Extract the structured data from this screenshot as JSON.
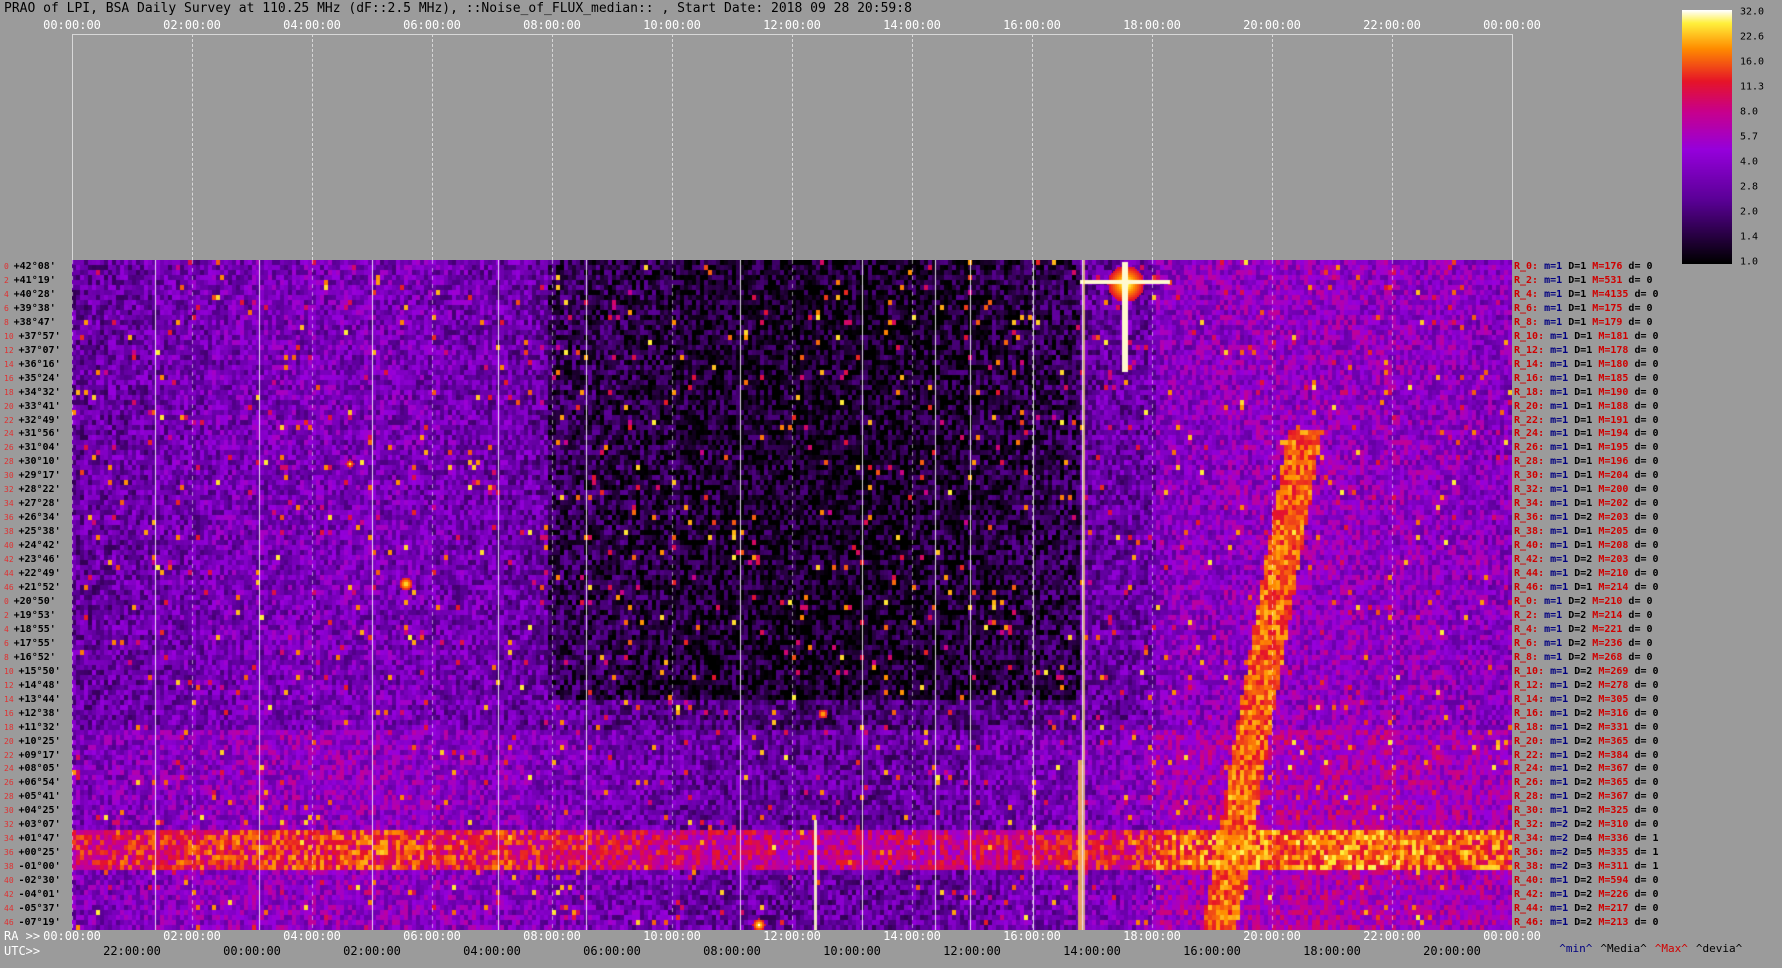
{
  "title": "PRAO of LPI, BSA Daily Survey at 110.25 MHz (dF::2.5 MHz), ::Noise_of_FLUX_median:: , Start Date: 2018 09 28 20:59:8",
  "top_ticks": [
    "00:00:00",
    "02:00:00",
    "04:00:00",
    "06:00:00",
    "08:00:00",
    "10:00:00",
    "12:00:00",
    "14:00:00",
    "16:00:00",
    "18:00:00",
    "20:00:00",
    "22:00:00",
    "00:00:00"
  ],
  "ra_label": "RA >>",
  "utc_label": "UTC>>",
  "ra_ticks": [
    "00:00:00",
    "02:00:00",
    "04:00:00",
    "06:00:00",
    "08:00:00",
    "10:00:00",
    "12:00:00",
    "14:00:00",
    "16:00:00",
    "18:00:00",
    "20:00:00",
    "22:00:00",
    "00:00:00"
  ],
  "utc_ticks": [
    "22:00:00",
    "00:00:00",
    "02:00:00",
    "04:00:00",
    "06:00:00",
    "08:00:00",
    "10:00:00",
    "12:00:00",
    "14:00:00",
    "16:00:00",
    "18:00:00",
    "20:00:00"
  ],
  "legend_foot": {
    "min": "^min^",
    "media": "^Media^",
    "max": "^Max^",
    "devia": "^devia^"
  },
  "colors": {
    "background": "#9b9b9b",
    "min": "#000080",
    "media": "#000000",
    "max": "#d00000",
    "devia": "#000000"
  },
  "chart_data": {
    "type": "heatmap",
    "x_axis": {
      "label": "RA / UTC",
      "range": [
        "00:00:00",
        "24:00:00"
      ]
    },
    "declinations": [
      "+42°08'",
      "+41°19'",
      "+40°28'",
      "+39°38'",
      "+38°47'",
      "+37°57'",
      "+37°07'",
      "+36°16'",
      "+35°24'",
      "+34°32'",
      "+33°41'",
      "+32°49'",
      "+31°56'",
      "+31°04'",
      "+30°10'",
      "+29°17'",
      "+28°22'",
      "+27°28'",
      "+26°34'",
      "+25°38'",
      "+24°42'",
      "+23°46'",
      "+22°49'",
      "+21°52'",
      "+20°50'",
      "+19°53'",
      "+18°55'",
      "+17°55'",
      "+16°52'",
      "+15°50'",
      "+14°48'",
      "+13°44'",
      "+12°38'",
      "+11°32'",
      "+10°25'",
      "+09°17'",
      "+08°05'",
      "+06°54'",
      "+05°41'",
      "+04°25'",
      "+03°07'",
      "+01°47'",
      "+00°25'",
      "-01°00'",
      "-02°30'",
      "-04°01'",
      "-05°37'",
      "-07°19'"
    ],
    "row_indices": [
      "0",
      "2",
      "4",
      "6",
      "8",
      "10",
      "12",
      "14",
      "16",
      "18",
      "20",
      "22",
      "24",
      "26",
      "28",
      "30",
      "32",
      "34",
      "36",
      "38",
      "40",
      "42",
      "44",
      "46",
      "0",
      "2",
      "4",
      "6",
      "8",
      "10",
      "12",
      "14",
      "16",
      "18",
      "20",
      "22",
      "24",
      "26",
      "28",
      "30",
      "32",
      "34",
      "36",
      "38",
      "40",
      "42",
      "44",
      "46"
    ],
    "colorbar": {
      "ticks": [
        "32.0",
        "22.6",
        "16.0",
        "11.3",
        "8.0",
        "5.7",
        "4.0",
        "2.8",
        "2.0",
        "1.4",
        "1.0"
      ],
      "range": [
        1.0,
        32.0
      ],
      "scale": "log"
    },
    "row_stats": [
      {
        "name": "R_0:",
        "m": "m=1",
        "D": "D=1",
        "M": "M=176",
        "d": "d= 0"
      },
      {
        "name": "R_2:",
        "m": "m=1",
        "D": "D=1",
        "M": "M=531",
        "d": "d= 0"
      },
      {
        "name": "R_4:",
        "m": "m=1",
        "D": "D=1",
        "M": "M=4135",
        "d": "d= 0"
      },
      {
        "name": "R_6:",
        "m": "m=1",
        "D": "D=1",
        "M": "M=175",
        "d": "d= 0"
      },
      {
        "name": "R_8:",
        "m": "m=1",
        "D": "D=1",
        "M": "M=179",
        "d": "d= 0"
      },
      {
        "name": "R_10:",
        "m": "m=1",
        "D": "D=1",
        "M": "M=181",
        "d": "d= 0"
      },
      {
        "name": "R_12:",
        "m": "m=1",
        "D": "D=1",
        "M": "M=178",
        "d": "d= 0"
      },
      {
        "name": "R_14:",
        "m": "m=1",
        "D": "D=1",
        "M": "M=180",
        "d": "d= 0"
      },
      {
        "name": "R_16:",
        "m": "m=1",
        "D": "D=1",
        "M": "M=185",
        "d": "d= 0"
      },
      {
        "name": "R_18:",
        "m": "m=1",
        "D": "D=1",
        "M": "M=190",
        "d": "d= 0"
      },
      {
        "name": "R_20:",
        "m": "m=1",
        "D": "D=1",
        "M": "M=188",
        "d": "d= 0"
      },
      {
        "name": "R_22:",
        "m": "m=1",
        "D": "D=1",
        "M": "M=191",
        "d": "d= 0"
      },
      {
        "name": "R_24:",
        "m": "m=1",
        "D": "D=1",
        "M": "M=194",
        "d": "d= 0"
      },
      {
        "name": "R_26:",
        "m": "m=1",
        "D": "D=1",
        "M": "M=195",
        "d": "d= 0"
      },
      {
        "name": "R_28:",
        "m": "m=1",
        "D": "D=1",
        "M": "M=196",
        "d": "d= 0"
      },
      {
        "name": "R_30:",
        "m": "m=1",
        "D": "D=1",
        "M": "M=204",
        "d": "d= 0"
      },
      {
        "name": "R_32:",
        "m": "m=1",
        "D": "D=1",
        "M": "M=200",
        "d": "d= 0"
      },
      {
        "name": "R_34:",
        "m": "m=1",
        "D": "D=1",
        "M": "M=202",
        "d": "d= 0"
      },
      {
        "name": "R_36:",
        "m": "m=1",
        "D": "D=2",
        "M": "M=203",
        "d": "d= 0"
      },
      {
        "name": "R_38:",
        "m": "m=1",
        "D": "D=1",
        "M": "M=205",
        "d": "d= 0"
      },
      {
        "name": "R_40:",
        "m": "m=1",
        "D": "D=1",
        "M": "M=208",
        "d": "d= 0"
      },
      {
        "name": "R_42:",
        "m": "m=1",
        "D": "D=2",
        "M": "M=203",
        "d": "d= 0"
      },
      {
        "name": "R_44:",
        "m": "m=1",
        "D": "D=2",
        "M": "M=210",
        "d": "d= 0"
      },
      {
        "name": "R_46:",
        "m": "m=1",
        "D": "D=1",
        "M": "M=214",
        "d": "d= 0"
      },
      {
        "name": "R_0:",
        "m": "m=1",
        "D": "D=2",
        "M": "M=210",
        "d": "d= 0"
      },
      {
        "name": "R_2:",
        "m": "m=1",
        "D": "D=2",
        "M": "M=214",
        "d": "d= 0"
      },
      {
        "name": "R_4:",
        "m": "m=1",
        "D": "D=2",
        "M": "M=221",
        "d": "d= 0"
      },
      {
        "name": "R_6:",
        "m": "m=1",
        "D": "D=2",
        "M": "M=236",
        "d": "d= 0"
      },
      {
        "name": "R_8:",
        "m": "m=1",
        "D": "D=2",
        "M": "M=268",
        "d": "d= 0"
      },
      {
        "name": "R_10:",
        "m": "m=1",
        "D": "D=2",
        "M": "M=269",
        "d": "d= 0"
      },
      {
        "name": "R_12:",
        "m": "m=1",
        "D": "D=2",
        "M": "M=278",
        "d": "d= 0"
      },
      {
        "name": "R_14:",
        "m": "m=1",
        "D": "D=2",
        "M": "M=305",
        "d": "d= 0"
      },
      {
        "name": "R_16:",
        "m": "m=1",
        "D": "D=2",
        "M": "M=316",
        "d": "d= 0"
      },
      {
        "name": "R_18:",
        "m": "m=1",
        "D": "D=2",
        "M": "M=331",
        "d": "d= 0"
      },
      {
        "name": "R_20:",
        "m": "m=1",
        "D": "D=2",
        "M": "M=365",
        "d": "d= 0"
      },
      {
        "name": "R_22:",
        "m": "m=1",
        "D": "D=2",
        "M": "M=384",
        "d": "d= 0"
      },
      {
        "name": "R_24:",
        "m": "m=1",
        "D": "D=2",
        "M": "M=367",
        "d": "d= 0"
      },
      {
        "name": "R_26:",
        "m": "m=1",
        "D": "D=2",
        "M": "M=365",
        "d": "d= 0"
      },
      {
        "name": "R_28:",
        "m": "m=1",
        "D": "D=2",
        "M": "M=367",
        "d": "d= 0"
      },
      {
        "name": "R_30:",
        "m": "m=1",
        "D": "D=2",
        "M": "M=325",
        "d": "d= 0"
      },
      {
        "name": "R_32:",
        "m": "m=2",
        "D": "D=2",
        "M": "M=310",
        "d": "d= 0"
      },
      {
        "name": "R_34:",
        "m": "m=2",
        "D": "D=4",
        "M": "M=336",
        "d": "d= 1"
      },
      {
        "name": "R_36:",
        "m": "m=2",
        "D": "D=5",
        "M": "M=335",
        "d": "d= 1"
      },
      {
        "name": "R_38:",
        "m": "m=2",
        "D": "D=3",
        "M": "M=311",
        "d": "d= 1"
      },
      {
        "name": "R_40:",
        "m": "m=1",
        "D": "D=2",
        "M": "M=594",
        "d": "d= 0"
      },
      {
        "name": "R_42:",
        "m": "m=1",
        "D": "D=2",
        "M": "M=226",
        "d": "d= 0"
      },
      {
        "name": "R_44:",
        "m": "m=1",
        "D": "D=2",
        "M": "M=217",
        "d": "d= 0"
      },
      {
        "name": "R_46:",
        "m": "m=1",
        "D": "D=2",
        "M": "M=213",
        "d": "d= 0"
      }
    ]
  }
}
